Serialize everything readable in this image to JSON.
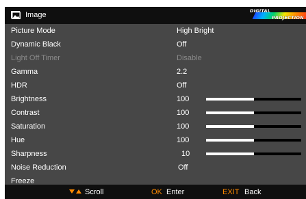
{
  "header": {
    "title": "Image",
    "logo_line1": "DIGITAL",
    "logo_line2": "PROJECTION"
  },
  "menu": [
    {
      "label": "Picture Mode",
      "value": "High Bright",
      "enabled": true
    },
    {
      "label": "Dynamic Black",
      "value": "Off",
      "enabled": true
    },
    {
      "label": "Light Off Timer",
      "value": "Disable",
      "enabled": false
    },
    {
      "label": "Gamma",
      "value": "2.2",
      "enabled": true
    },
    {
      "label": "HDR",
      "value": "Off",
      "enabled": true
    },
    {
      "label": "Brightness",
      "value": "100",
      "enabled": true,
      "level": 0.5
    },
    {
      "label": "Contrast",
      "value": "100",
      "enabled": true,
      "level": 0.5
    },
    {
      "label": "Saturation",
      "value": "100",
      "enabled": true,
      "level": 0.5
    },
    {
      "label": "Hue",
      "value": "100",
      "enabled": true,
      "level": 0.5
    },
    {
      "label": "Sharpness",
      "value": "10",
      "enabled": true,
      "level": 0.5
    },
    {
      "label": "Noise Reduction",
      "value": "Off",
      "enabled": true
    },
    {
      "label": "Freeze",
      "value": "",
      "enabled": true
    }
  ],
  "footer": {
    "scroll_label": "Scroll",
    "ok_key": "OK",
    "enter_label": "Enter",
    "exit_key": "EXIT",
    "back_label": "Back"
  },
  "colors": {
    "panel": "#474747",
    "bar_background": "#0f0f0f",
    "disabled_text": "#8a8a8a",
    "key_accent": "#ff8a00",
    "slider_track": "#000000",
    "slider_fill": "#ffffff"
  },
  "icons": {
    "header": "image-icon",
    "scroll": "up-down-arrows-icon"
  }
}
